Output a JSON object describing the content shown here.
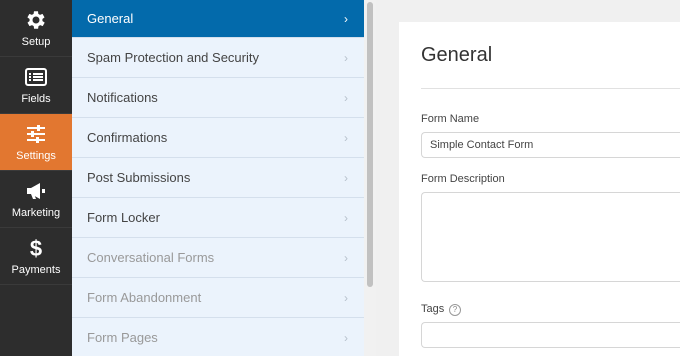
{
  "rail": {
    "items": [
      {
        "label": "Setup",
        "icon": "gear-icon"
      },
      {
        "label": "Fields",
        "icon": "fields-list-icon"
      },
      {
        "label": "Settings",
        "icon": "sliders-icon",
        "active": true
      },
      {
        "label": "Marketing",
        "icon": "megaphone-icon"
      },
      {
        "label": "Payments",
        "icon": "dollar-icon"
      }
    ]
  },
  "menu": {
    "items": [
      {
        "label": "General",
        "state": "active"
      },
      {
        "label": "Spam Protection and Security",
        "state": "normal"
      },
      {
        "label": "Notifications",
        "state": "normal"
      },
      {
        "label": "Confirmations",
        "state": "normal"
      },
      {
        "label": "Post Submissions",
        "state": "normal"
      },
      {
        "label": "Form Locker",
        "state": "normal"
      },
      {
        "label": "Conversational Forms",
        "state": "disabled"
      },
      {
        "label": "Form Abandonment",
        "state": "disabled"
      },
      {
        "label": "Form Pages",
        "state": "disabled"
      }
    ],
    "chevron": "›"
  },
  "panel": {
    "title": "General",
    "form_name_label": "Form Name",
    "form_name_value": "Simple Contact Form",
    "form_description_label": "Form Description",
    "tags_label": "Tags",
    "help_glyph": "?"
  },
  "colors": {
    "rail_bg": "#2d2d2d",
    "rail_active": "#e27730",
    "menu_active": "#036aab",
    "menu_bg": "#ebf3fc"
  }
}
